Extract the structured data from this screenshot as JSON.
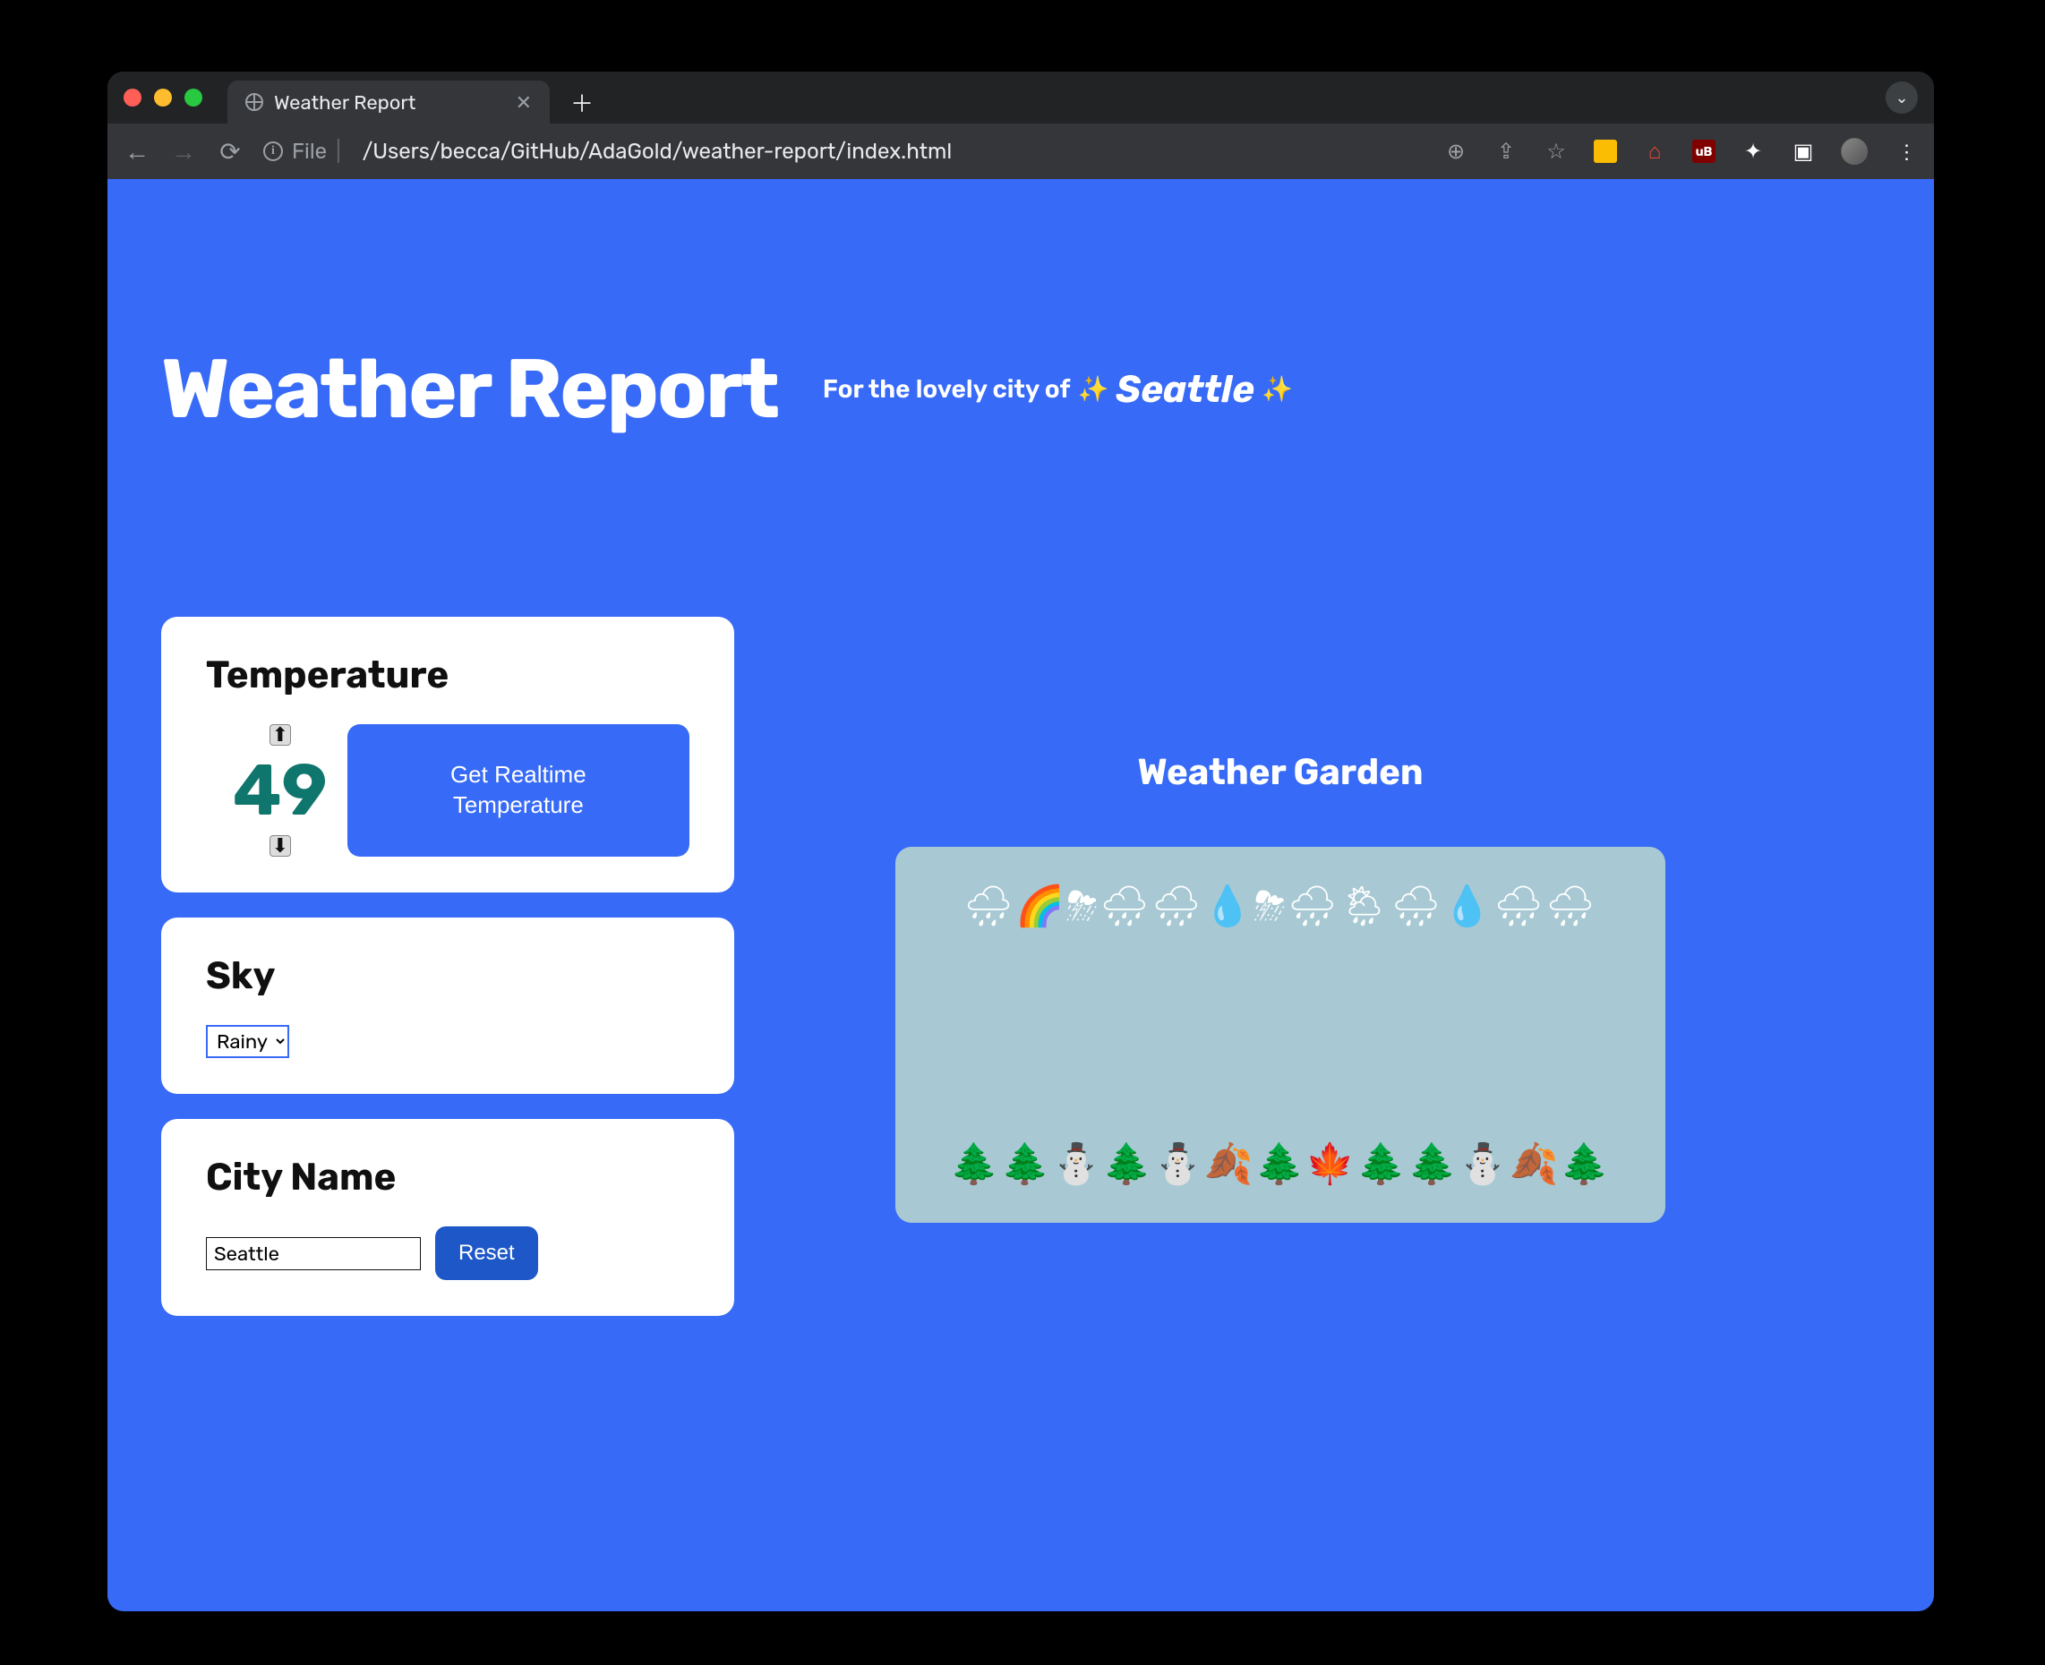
{
  "browser": {
    "tab_title": "Weather Report",
    "url_prefix": "File",
    "url_path": "/Users/becca/GitHub/AdaGold/weather-report/index.html"
  },
  "header": {
    "title": "Weather Report",
    "tagline_prefix": "For the lovely city of",
    "sparkle": "✨",
    "city": "Seattle"
  },
  "temperature": {
    "heading": "Temperature",
    "value": "49",
    "up_label": "⬆",
    "down_label": "⬇",
    "realtime_button": "Get Realtime Temperature",
    "value_color": "#0f766e"
  },
  "sky": {
    "heading": "Sky",
    "selected": "Rainy"
  },
  "city_card": {
    "heading": "City Name",
    "input_value": "Seattle",
    "reset_label": "Reset"
  },
  "garden": {
    "title": "Weather Garden",
    "background": "#a8c9d4",
    "sky_row": "🌧🌈⛈🌧🌧💧⛈🌧🌦🌧💧🌧🌧",
    "ground_row": "🌲🌲⛄️🌲⛄️🍂🌲🍁🌲🌲⛄️🍂🌲"
  },
  "colors": {
    "accent": "#376af7",
    "accent_dark": "#1e57c7"
  }
}
